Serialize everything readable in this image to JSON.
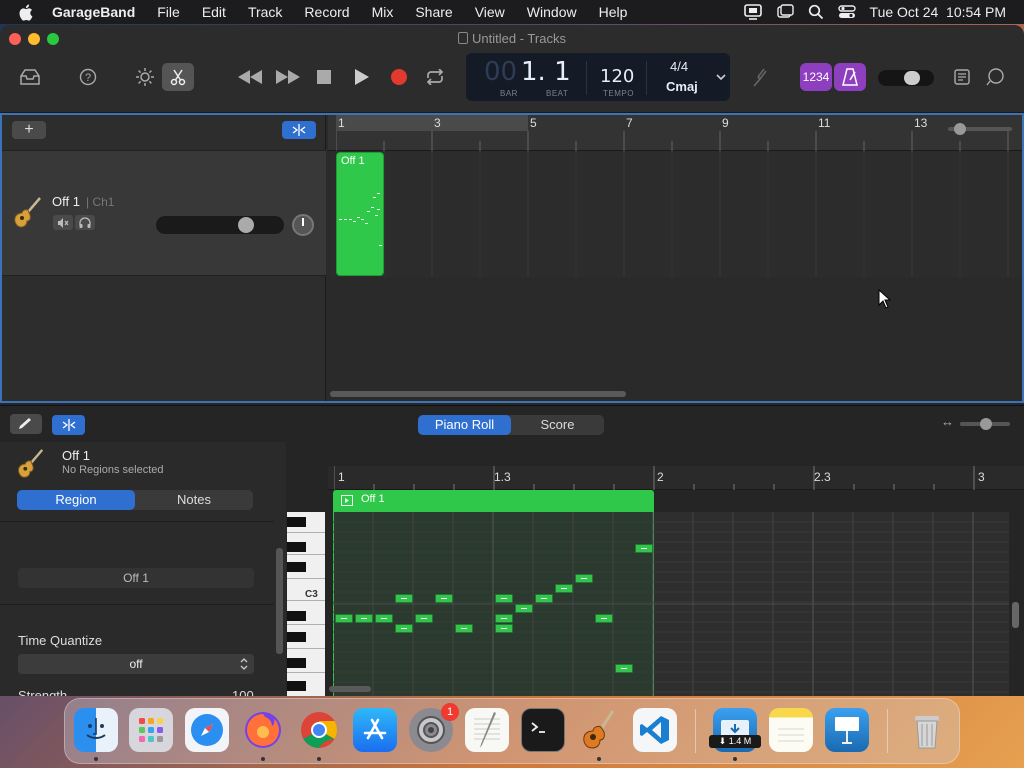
{
  "menubar": {
    "app": "GarageBand",
    "items": [
      "File",
      "Edit",
      "Track",
      "Record",
      "Mix",
      "Share",
      "View",
      "Window",
      "Help"
    ],
    "clock": "Tue Oct 24  10:54 PM"
  },
  "window": {
    "title": "Untitled - Tracks"
  },
  "lcd": {
    "position_dim": "00",
    "position": "1. 1",
    "bar_label": "BAR",
    "beat_label": "BEAT",
    "tempo": "120",
    "tempo_label": "TEMPO",
    "time_signature": "4/4",
    "key": "Cmaj"
  },
  "count_in": "1234",
  "tracks": {
    "ruler": [
      "1",
      "3",
      "5",
      "7",
      "9",
      "11",
      "13"
    ],
    "track": {
      "name": "Off 1",
      "channel": "| Ch1"
    },
    "region_label": "Off 1"
  },
  "editor": {
    "tabs": [
      "Piano Roll",
      "Score"
    ],
    "active_tab": "Piano Roll",
    "region_name": "Off 1",
    "region_status": "No Regions selected",
    "inspector_tabs": [
      "Region",
      "Notes"
    ],
    "region_field": "Off 1",
    "time_quantize_label": "Time Quantize",
    "time_quantize_value": "off",
    "strength_label": "Strength",
    "strength_value": "100",
    "ruler": [
      "1",
      "1.3",
      "2",
      "2.3",
      "3"
    ],
    "piano_region_label": "Off 1",
    "key_label": "C3"
  },
  "dock": {
    "badge": "1",
    "download": "1.4 M"
  },
  "colors": {
    "accent": "#2f6fd0",
    "region": "#2fc84a",
    "record": "#e23a2e",
    "selection_border": "#3c72b8"
  }
}
